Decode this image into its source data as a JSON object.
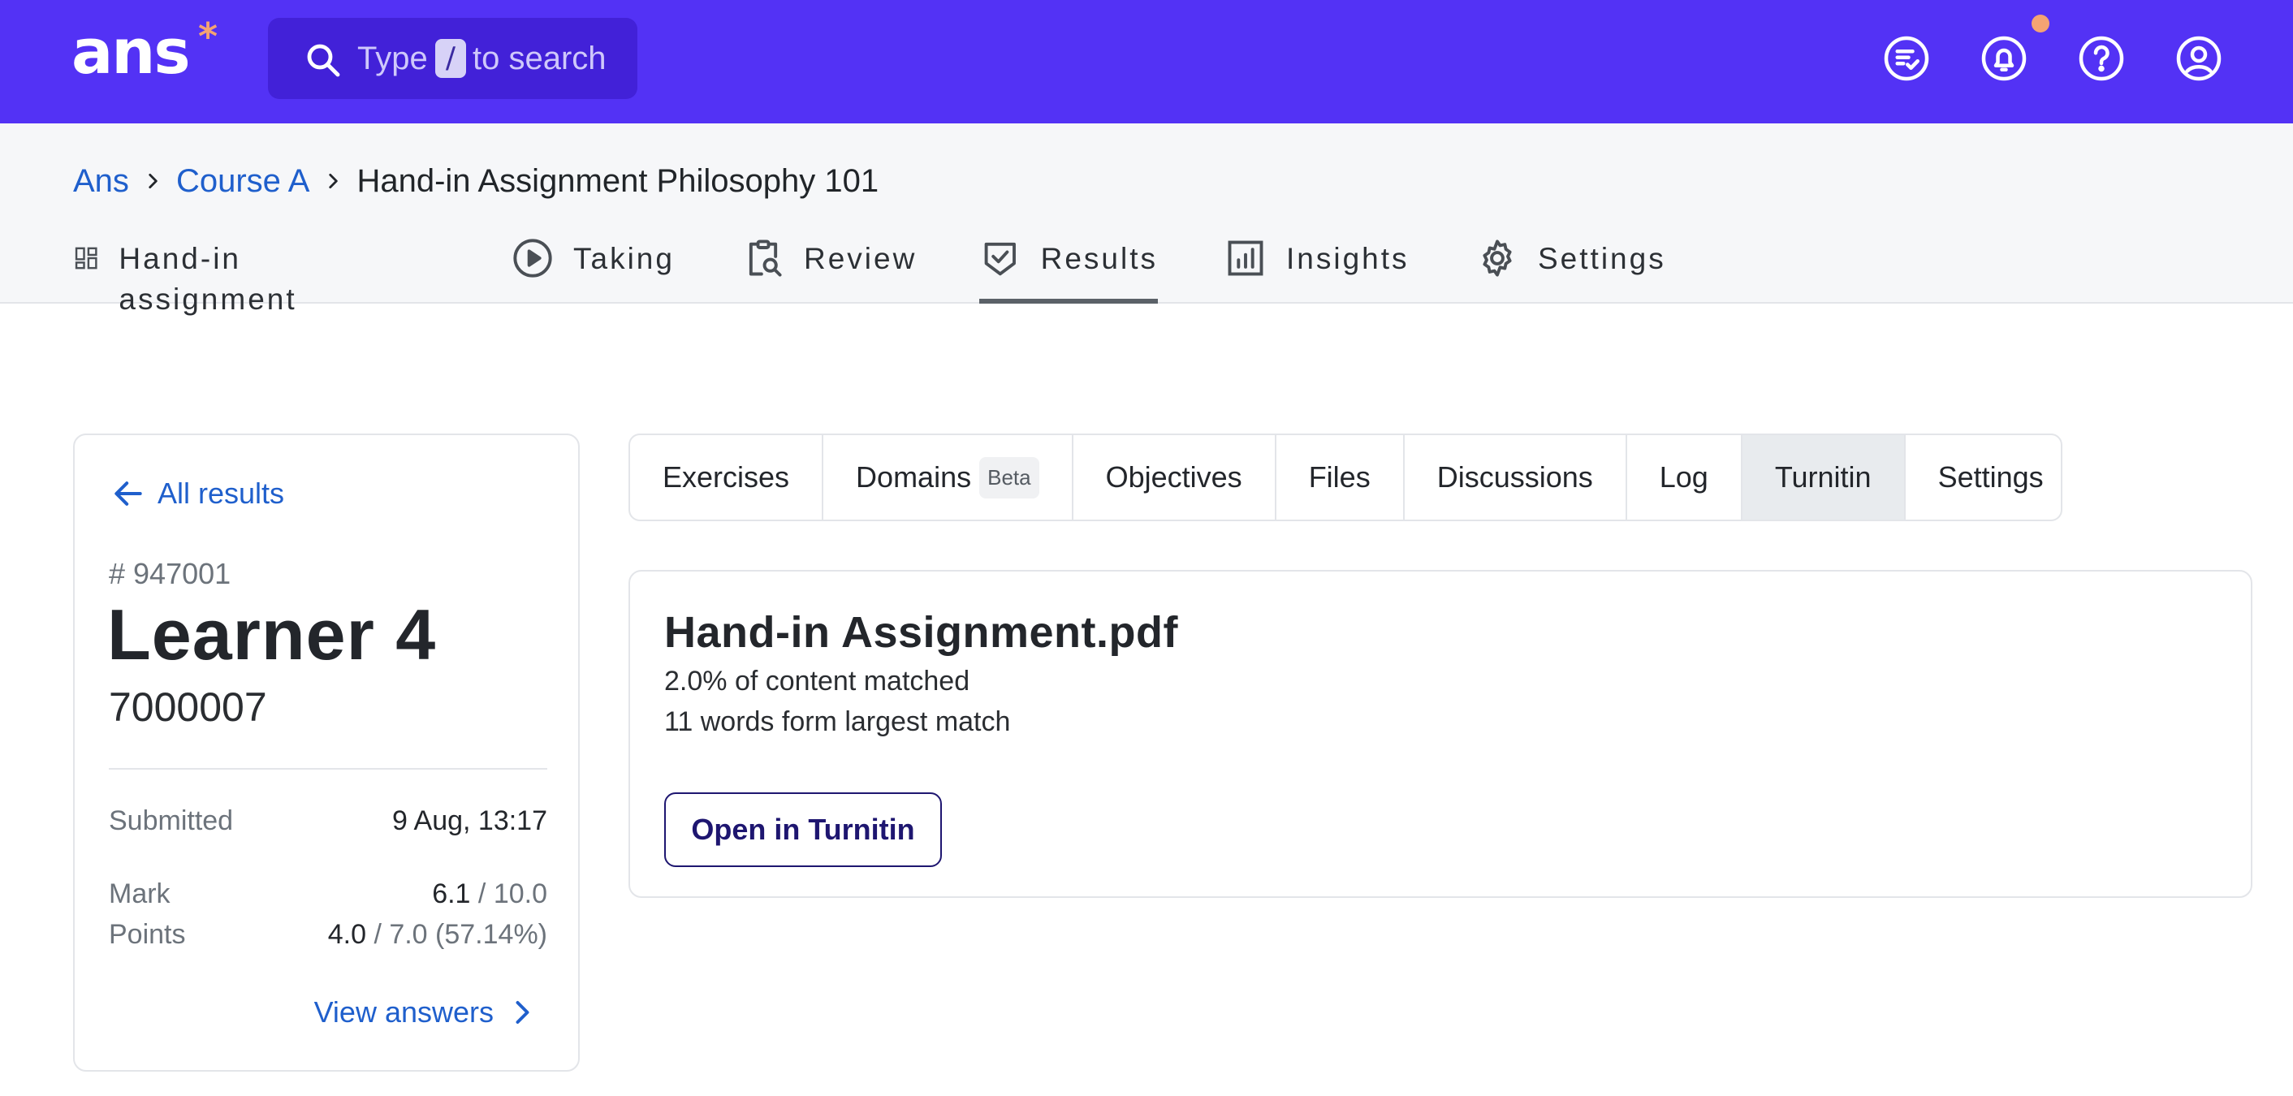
{
  "app": {
    "logo_text": "ans",
    "logo_star": "*"
  },
  "search": {
    "label_before": "Type",
    "key": "/",
    "label_after": "to search"
  },
  "top_icons": [
    "checklist-icon",
    "bell-icon",
    "help-icon",
    "user-icon"
  ],
  "colors": {
    "brand": "#5332f5",
    "accent": "#f4a373",
    "link": "#1f5fcc"
  },
  "breadcrumb": [
    {
      "label": "Ans"
    },
    {
      "label": "Course A"
    },
    {
      "label": "Hand-in Assignment Philosophy 101"
    }
  ],
  "main_tabs": [
    {
      "label": "Hand-in assignment",
      "icon": "dashboard-icon"
    },
    {
      "label": "Taking",
      "icon": "play-icon"
    },
    {
      "label": "Review",
      "icon": "clipboard-search-icon"
    },
    {
      "label": "Results",
      "icon": "shield-check-icon",
      "active": true
    },
    {
      "label": "Insights",
      "icon": "bar-chart-icon"
    },
    {
      "label": "Settings",
      "icon": "gear-icon"
    }
  ],
  "learner": {
    "back_label": "All results",
    "id": "# 947001",
    "name": "Learner 4",
    "number": "7000007",
    "submitted_label": "Submitted",
    "submitted_value": "9 Aug, 13:17",
    "mark_label": "Mark",
    "mark_value": "6.1",
    "mark_max": "/ 10.0",
    "points_label": "Points",
    "points_value": "4.0",
    "points_max": "/ 7.0 (57.14%)",
    "view_answers": "View answers"
  },
  "sub_tabs": [
    {
      "label": "Exercises"
    },
    {
      "label": "Domains",
      "badge": "Beta"
    },
    {
      "label": "Objectives"
    },
    {
      "label": "Files"
    },
    {
      "label": "Discussions"
    },
    {
      "label": "Log"
    },
    {
      "label": "Turnitin",
      "active": true
    },
    {
      "label": "Settings"
    }
  ],
  "turnitin": {
    "file_name": "Hand-in Assignment.pdf",
    "matched": "2.0% of content matched",
    "largest_match": "11 words form largest match",
    "open_button": "Open in Turnitin"
  }
}
